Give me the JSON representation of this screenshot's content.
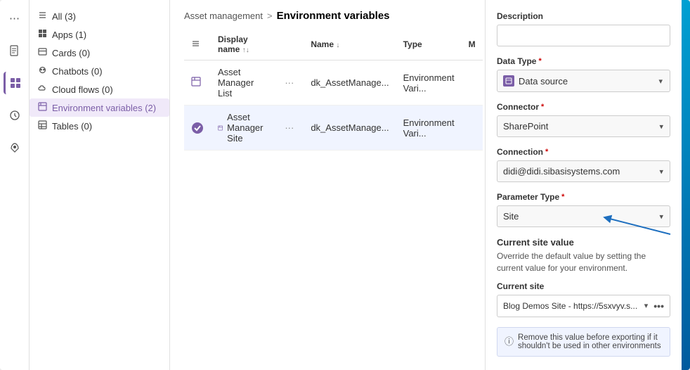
{
  "breadcrumb": {
    "parent": "Asset management",
    "separator": ">",
    "current": "Environment variables"
  },
  "sidebar": {
    "items": [
      {
        "label": "All (3)",
        "icon": "≡",
        "active": false
      },
      {
        "label": "Apps (1)",
        "icon": "⊞",
        "active": false
      },
      {
        "label": "Cards (0)",
        "icon": "▣",
        "active": false
      },
      {
        "label": "Chatbots (0)",
        "icon": "◎",
        "active": false
      },
      {
        "label": "Cloud flows (0)",
        "icon": "⌀",
        "active": false
      },
      {
        "label": "Environment variables (2)",
        "icon": "⊞",
        "active": true
      },
      {
        "label": "Tables (0)",
        "icon": "⊞",
        "active": false
      }
    ]
  },
  "table": {
    "columns": [
      {
        "label": "Display name",
        "sortable": true
      },
      {
        "label": "",
        "sortable": false
      },
      {
        "label": "Name",
        "sortable": true
      },
      {
        "label": "Type",
        "sortable": false
      },
      {
        "label": "M",
        "sortable": false
      }
    ],
    "rows": [
      {
        "icon": "▦",
        "displayName": "Asset Manager List",
        "name": "dk_AssetManage...",
        "type": "Environment Vari...",
        "selected": false,
        "checked": false
      },
      {
        "icon": "▦",
        "displayName": "Asset Manager Site",
        "name": "dk_AssetManage...",
        "type": "Environment Vari...",
        "selected": true,
        "checked": true
      }
    ]
  },
  "right_panel": {
    "description_label": "Description",
    "description_placeholder": "",
    "data_type_label": "Data Type",
    "data_type_value": "Data source",
    "connector_label": "Connector",
    "connector_value": "SharePoint",
    "connection_label": "Connection",
    "connection_value": "didi@didi.sibasisystems.com",
    "parameter_type_label": "Parameter Type",
    "parameter_type_value": "Site",
    "current_site_value_title": "Current site value",
    "current_site_value_desc": "Override the default value by setting the current value for your environment.",
    "current_site_label": "Current site",
    "current_site_value": "Blog Demos Site - https://5sxvyv.s...",
    "info_text": "Remove this value before exporting if it shouldn't be used in other environments"
  },
  "icons": {
    "all_icon": "≡",
    "apps_icon": "⊞",
    "cards_icon": "▣",
    "chatbots_icon": "◎",
    "cloud_flows_icon": "ↄ",
    "env_vars_icon": "⊟",
    "tables_icon": "⊞",
    "check_icon": "✓",
    "chevron_down": "▾",
    "dots_icon": "•••",
    "info_circle": "ⓘ"
  }
}
